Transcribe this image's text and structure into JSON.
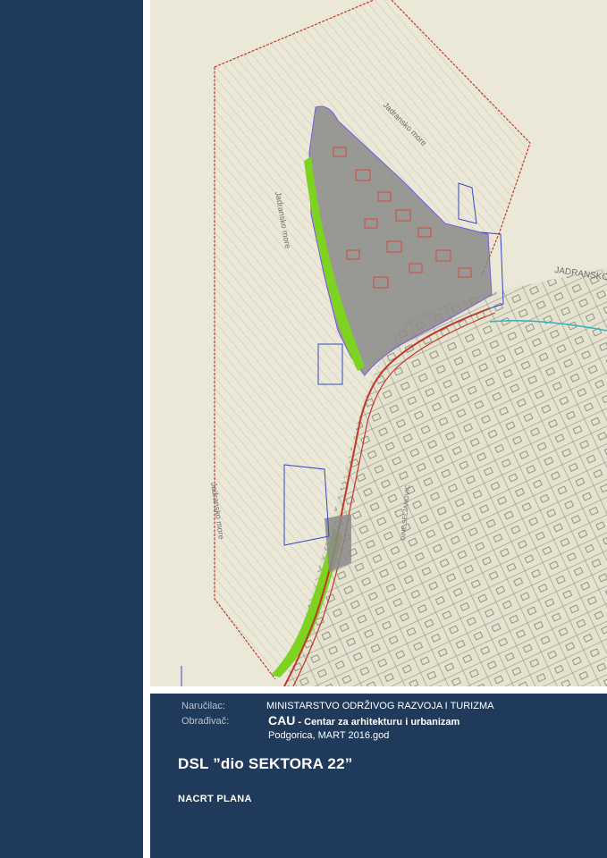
{
  "map": {
    "sea_labels": [
      "Jadransko more",
      "Jadransko more",
      "Jadransko more",
      "JADRANSKO"
    ],
    "street_label": "DINE SELJANOVIC"
  },
  "info": {
    "client_label": "Naručilac:",
    "client_value": "MINISTARSTVO ODRŽIVOG RAZVOJA I TURIZMA",
    "processor_label": "Obrađivač:",
    "processor_name": "CAU",
    "processor_desc": " - Centar za arhitekturu i urbanizam",
    "place_date": "Podgorica, MART 2016.god"
  },
  "title": "DSL ”dio SEKTORA 22”",
  "subtitle": "NACRT PLANA",
  "colors": {
    "navy": "#203a5c",
    "map_bg": "#ece8d8",
    "boundary": "#c0392b",
    "green": "#7ed321",
    "grey_zone": "#8a8a8a"
  }
}
